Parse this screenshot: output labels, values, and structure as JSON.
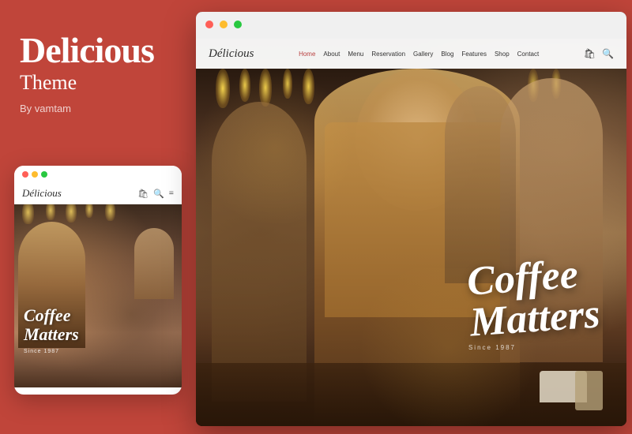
{
  "left": {
    "title": "Delicious",
    "subtitle": "Theme",
    "byline": "By vamtam"
  },
  "mobile": {
    "logo": "Délicious",
    "coffee_text_line1": "Coffee",
    "coffee_text_line2": "Matters",
    "since": "Since 1987"
  },
  "browser": {
    "nav": {
      "logo": "Délicious",
      "links": [
        "Home",
        "About",
        "Menu",
        "Reservation",
        "Gallery",
        "Blog",
        "Features",
        "Shop",
        "Contact"
      ]
    },
    "hero": {
      "coffee_line1": "Coffee",
      "coffee_line2": "Matters",
      "since": "Since 1987"
    }
  },
  "dots": {
    "red": "#ff5f57",
    "yellow": "#febc2e",
    "green": "#28c840"
  },
  "colors": {
    "bg": "#c0453a",
    "accent": "#b84040"
  }
}
